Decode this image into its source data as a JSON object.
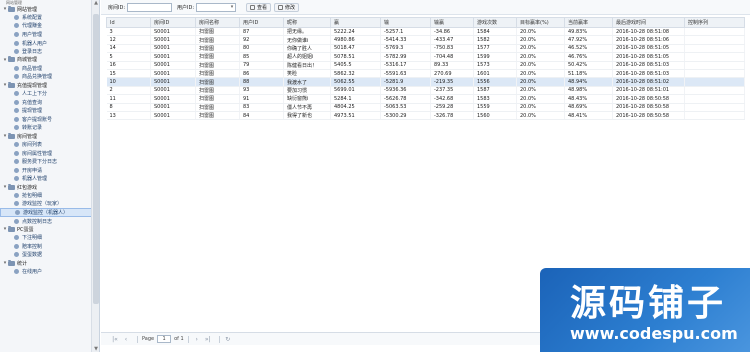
{
  "sidebar": {
    "title": "网站管理",
    "groups": [
      {
        "label": "网站管理",
        "items": [
          "系统配置",
          "代理赚金",
          "用户管理",
          "机器人用户",
          "登录日志"
        ]
      },
      {
        "label": "商城管理",
        "items": [
          "商品管理",
          "商品兑换管理"
        ]
      },
      {
        "label": "充值提现管理",
        "items": [
          "人工上下分",
          "充值查询",
          "提现管理",
          "客户提现账号",
          "转账记录"
        ]
      },
      {
        "label": "房间管理",
        "items": [
          "房间列表",
          "房间属性管理",
          "服务费下分日志",
          "开房申请",
          "机器人管理"
        ]
      },
      {
        "label": "红包游戏",
        "items": [
          "抢包明细",
          "游戏监控（玩家）",
          "游戏监控（机器人）",
          "点数控制日志"
        ]
      },
      {
        "label": "PC蛋蛋",
        "items": [
          "下注明细",
          "赔率控制",
          "蛋蛋数据"
        ]
      },
      {
        "label": "统计",
        "items": [
          "在线用户"
        ]
      }
    ],
    "active_item": "游戏监控（机器人）"
  },
  "toolbar": {
    "room_label": "房间ID:",
    "user_label": "用户ID:",
    "search_label": "查看",
    "edit_label": "修改"
  },
  "table": {
    "headers": [
      "Id",
      "房间ID",
      "房间名称",
      "用户ID",
      "昵称",
      "赢",
      "输",
      "输赢",
      "游戏次数",
      "目标赢率(%)",
      "当前赢率",
      "最后游戏时间",
      "控制序列"
    ],
    "rows": [
      [
        "3",
        "S0001",
        "扫雷图",
        "87",
        "把无缘。",
        "5222.24",
        "-5257.1",
        "-34.86",
        "1584",
        "20.0%",
        "49.83%",
        "2016-10-28 08:51:08",
        ""
      ],
      [
        "12",
        "S0001",
        "扫雷图",
        "92",
        "无你做谁i",
        "4980.86",
        "-5414.33",
        "-433.47",
        "1582",
        "20.0%",
        "47.92%",
        "2016-10-28 08:51:06",
        ""
      ],
      [
        "14",
        "S0001",
        "扫雷图",
        "80",
        "你确了胜人",
        "5018.47",
        "-5769.3",
        "-750.83",
        "1577",
        "20.0%",
        "46.52%",
        "2016-10-28 08:51:05",
        ""
      ],
      [
        "5",
        "S0001",
        "扫雷图",
        "85",
        "超人的姐姐i",
        "5078.51",
        "-5782.99",
        "-704.48",
        "1599",
        "20.0%",
        "46.76%",
        "2016-10-28 08:51:05",
        ""
      ],
      [
        "16",
        "S0001",
        "扫雷图",
        "79",
        "陈健看日出！",
        "5405.5",
        "-5316.17",
        "89.33",
        "1573",
        "20.0%",
        "50.42%",
        "2016-10-28 08:51:03",
        ""
      ],
      [
        "15",
        "S0001",
        "扫雷图",
        "86",
        "笑睑",
        "5862.32",
        "-5591.63",
        "270.69",
        "1601",
        "20.0%",
        "51.18%",
        "2016-10-28 08:51:03",
        ""
      ],
      [
        "10",
        "S0001",
        "扫雷图",
        "88",
        "我渡水了",
        "5062.55",
        "-5281.9",
        "-219.35",
        "1556",
        "20.0%",
        "48.94%",
        "2016-10-28 08:51:02",
        ""
      ],
      [
        "2",
        "S0001",
        "扫雷图",
        "93",
        "要加习惯",
        "5699.01",
        "-5936.36",
        "-237.35",
        "1587",
        "20.0%",
        "48.98%",
        "2016-10-28 08:51:01",
        ""
      ],
      [
        "11",
        "S0001",
        "扫雷图",
        "91",
        "缺衍窗熊i",
        "5284.1",
        "-5626.78",
        "-342.68",
        "1583",
        "20.0%",
        "48.43%",
        "2016-10-28 08:50:58",
        ""
      ],
      [
        "8",
        "S0001",
        "扫雷图",
        "83",
        "僵人节不再",
        "4804.25",
        "-5063.53",
        "-259.28",
        "1559",
        "20.0%",
        "48.69%",
        "2016-10-28 08:50:58",
        ""
      ],
      [
        "13",
        "S0001",
        "扫雷图",
        "84",
        "我得了新也",
        "4973.51",
        "-5300.29",
        "-326.78",
        "1560",
        "20.0%",
        "48.41%",
        "2016-10-28 08:50:58",
        ""
      ]
    ],
    "selected_row": 6
  },
  "pager": {
    "page_label": "Page",
    "page_value": "1",
    "of_label": "of 1"
  },
  "watermark": {
    "main": "源码铺子",
    "url": "www.codespu.com"
  }
}
